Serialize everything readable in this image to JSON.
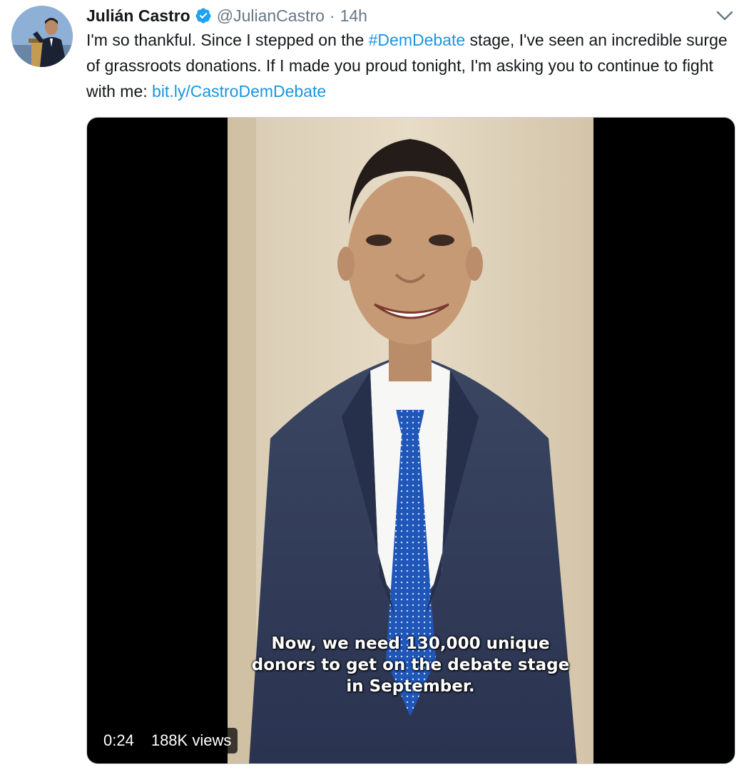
{
  "tweet": {
    "author_name": "Julián Castro",
    "handle": "@JulianCastro",
    "separator": "·",
    "time": "14h",
    "text": {
      "part1": "I'm so thankful. Since I stepped on the ",
      "hashtag": "#DemDebate",
      "part2": " stage, I've seen an incredible surge of grassroots donations. If I made you proud tonight, I'm asking you to continue to fight with me: ",
      "link": "bit.ly/CastroDemDebate"
    },
    "verified": true
  },
  "video": {
    "caption": "Now, we need 130,000 unique donors to get on the debate stage in September.",
    "duration": "0:24",
    "views": "188K views"
  },
  "colors": {
    "link": "#1b95e0",
    "secondary_text": "#657786",
    "verified_badge": "#1da1f2"
  },
  "icons": {
    "verified": "verified-badge-icon",
    "caret": "chevron-down-icon"
  }
}
